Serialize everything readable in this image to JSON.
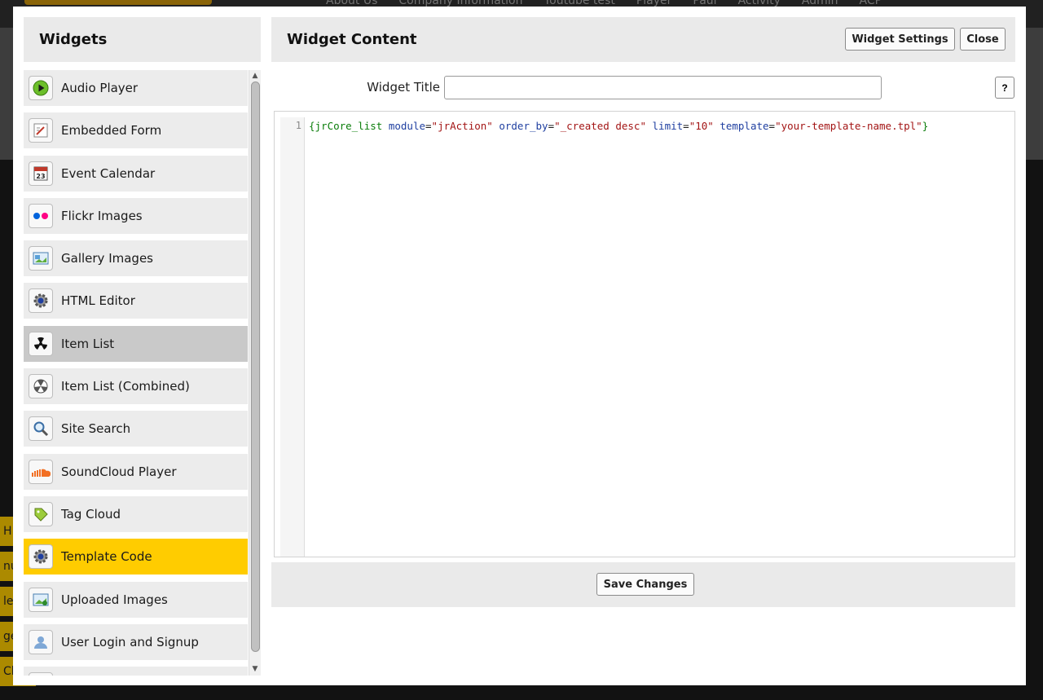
{
  "background": {
    "nav_items": [
      "About Us",
      "Company Information",
      "Youtube test",
      "Player",
      "Paul",
      "Activity",
      "Admin",
      "ACP"
    ],
    "side_tabs": [
      "H",
      "nu",
      "let",
      "ge",
      "Cl"
    ]
  },
  "modal": {
    "widgets_title": "Widgets",
    "content_title": "Widget Content",
    "settings_button": "Widget Settings",
    "close_button": "Close",
    "title_label": "Widget Title",
    "title_value": "",
    "help_button": "?",
    "save_button": "Save Changes",
    "scroll_up": "▲",
    "scroll_down": "▼"
  },
  "widgets": [
    {
      "label": "Audio Player",
      "icon": "play-icon",
      "state": "normal"
    },
    {
      "label": "Embedded Form",
      "icon": "form-icon",
      "state": "normal"
    },
    {
      "label": "Event Calendar",
      "icon": "calendar-icon",
      "state": "normal"
    },
    {
      "label": "Flickr Images",
      "icon": "flickr-icon",
      "state": "normal"
    },
    {
      "label": "Gallery Images",
      "icon": "gallery-icon",
      "state": "normal"
    },
    {
      "label": "HTML Editor",
      "icon": "gear-icon",
      "state": "normal"
    },
    {
      "label": "Item List",
      "icon": "radiation-icon",
      "state": "hover"
    },
    {
      "label": "Item List (Combined)",
      "icon": "radiation-outline-icon",
      "state": "normal"
    },
    {
      "label": "Site Search",
      "icon": "search-icon",
      "state": "normal"
    },
    {
      "label": "SoundCloud Player",
      "icon": "soundcloud-icon",
      "state": "normal"
    },
    {
      "label": "Tag Cloud",
      "icon": "tag-icon",
      "state": "normal"
    },
    {
      "label": "Template Code",
      "icon": "gear-icon",
      "state": "selected"
    },
    {
      "label": "Uploaded Images",
      "icon": "upload-image-icon",
      "state": "normal"
    },
    {
      "label": "User Login and Signup",
      "icon": "user-icon",
      "state": "normal"
    },
    {
      "label": "",
      "icon": "",
      "state": "normal"
    }
  ],
  "editor": {
    "line_number": "1",
    "code": {
      "open": "{",
      "tag": "jrCore_list",
      "attr1_name": "module",
      "attr1_value": "\"jrAction\"",
      "attr2_name": "order_by",
      "attr2_value": "\"_created desc\"",
      "attr3_name": "limit",
      "attr3_value": "\"10\"",
      "attr4_name": "template",
      "attr4_value": "\"your-template-name.tpl\"",
      "close": "}"
    }
  },
  "colors": {
    "selected": "#ffcc00",
    "hover": "#c9c9c9",
    "item_bg": "#ececec",
    "header_bg": "#eaeaea"
  }
}
